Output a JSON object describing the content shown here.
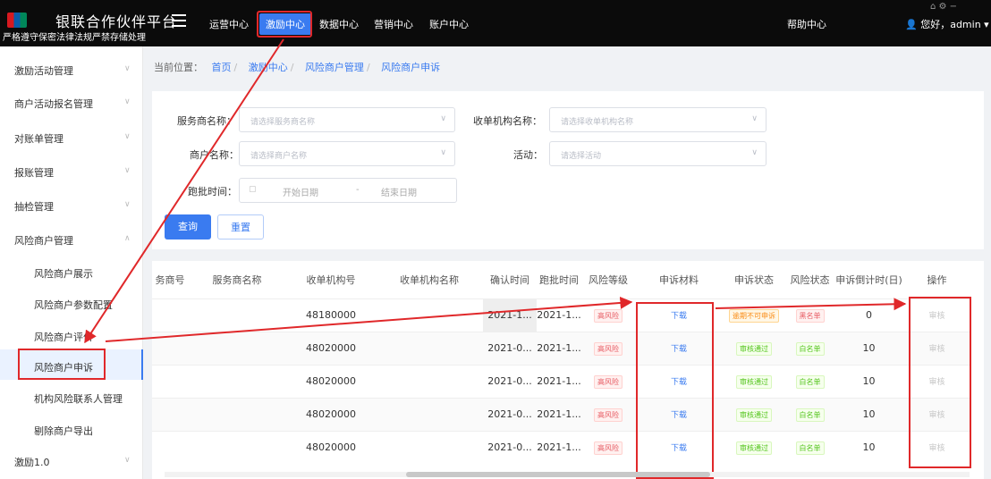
{
  "brand": {
    "title": "银联合作伙伴平台",
    "subtitle": "严格遵守保密法律法规严禁存储处理"
  },
  "nav": [
    "运营中心",
    "激励中心",
    "数据中心",
    "营销中心",
    "账户中心"
  ],
  "help": "帮助中心",
  "user": "您好，admin",
  "sidebar": {
    "items": [
      "激励活动管理",
      "商户活动报名管理",
      "对账单管理",
      "报账管理",
      "抽检管理",
      "风险商户管理"
    ],
    "sub": [
      "风险商户展示",
      "风险商户参数配置",
      "风险商户评价",
      "风险商户申诉",
      "机构风险联系人管理",
      "剔除商户导出"
    ],
    "last": "激励1.0"
  },
  "breadcrumb": {
    "prefix": "当前位置：",
    "items": [
      "首页",
      "激励中心",
      "风险商户管理",
      "风险商户申诉"
    ]
  },
  "filters": {
    "service_provider": {
      "label": "服务商名称：",
      "placeholder": "请选择服务商名称"
    },
    "acquirer": {
      "label": "收单机构名称：",
      "placeholder": "请选择收单机构名称"
    },
    "merchant": {
      "label": "商户名称：",
      "placeholder": "请选择商户名称"
    },
    "activity": {
      "label": "活动：",
      "placeholder": "请选择活动"
    },
    "date": {
      "label": "跑批时间：",
      "start": "开始日期",
      "sep": "-",
      "end": "结束日期"
    }
  },
  "buttons": {
    "query": "查询",
    "reset": "重置"
  },
  "table": {
    "headers": [
      "务商号",
      "服务商名称",
      "收单机构号",
      "收单机构名称",
      "确认时间",
      "跑批时间",
      "风险等级",
      "申诉材料",
      "申诉状态",
      "风险状态",
      "申诉倒计时(日)",
      "操作"
    ],
    "rows": [
      {
        "acquirer": "48180000",
        "confirm": "2021-1...",
        "batch": "2021-1...",
        "risk": "高风险",
        "material": "下载",
        "status": "逾期不可申诉",
        "risk_state": "黑名单",
        "countdown": "0",
        "op": "审核"
      },
      {
        "acquirer": "48020000",
        "confirm": "2021-0...",
        "batch": "2021-1...",
        "risk": "高风险",
        "material": "下载",
        "status": "审核通过",
        "risk_state": "白名单",
        "countdown": "10",
        "op": "审核"
      },
      {
        "acquirer": "48020000",
        "confirm": "2021-0...",
        "batch": "2021-1...",
        "risk": "高风险",
        "material": "下载",
        "status": "审核通过",
        "risk_state": "白名单",
        "countdown": "10",
        "op": "审核"
      },
      {
        "acquirer": "48020000",
        "confirm": "2021-0...",
        "batch": "2021-1...",
        "risk": "高风险",
        "material": "下载",
        "status": "审核通过",
        "risk_state": "白名单",
        "countdown": "10",
        "op": "审核"
      },
      {
        "acquirer": "48020000",
        "confirm": "2021-0...",
        "batch": "2021-1...",
        "risk": "高风险",
        "material": "下载",
        "status": "审核通过",
        "risk_state": "白名单",
        "countdown": "10",
        "op": "审核"
      }
    ]
  }
}
